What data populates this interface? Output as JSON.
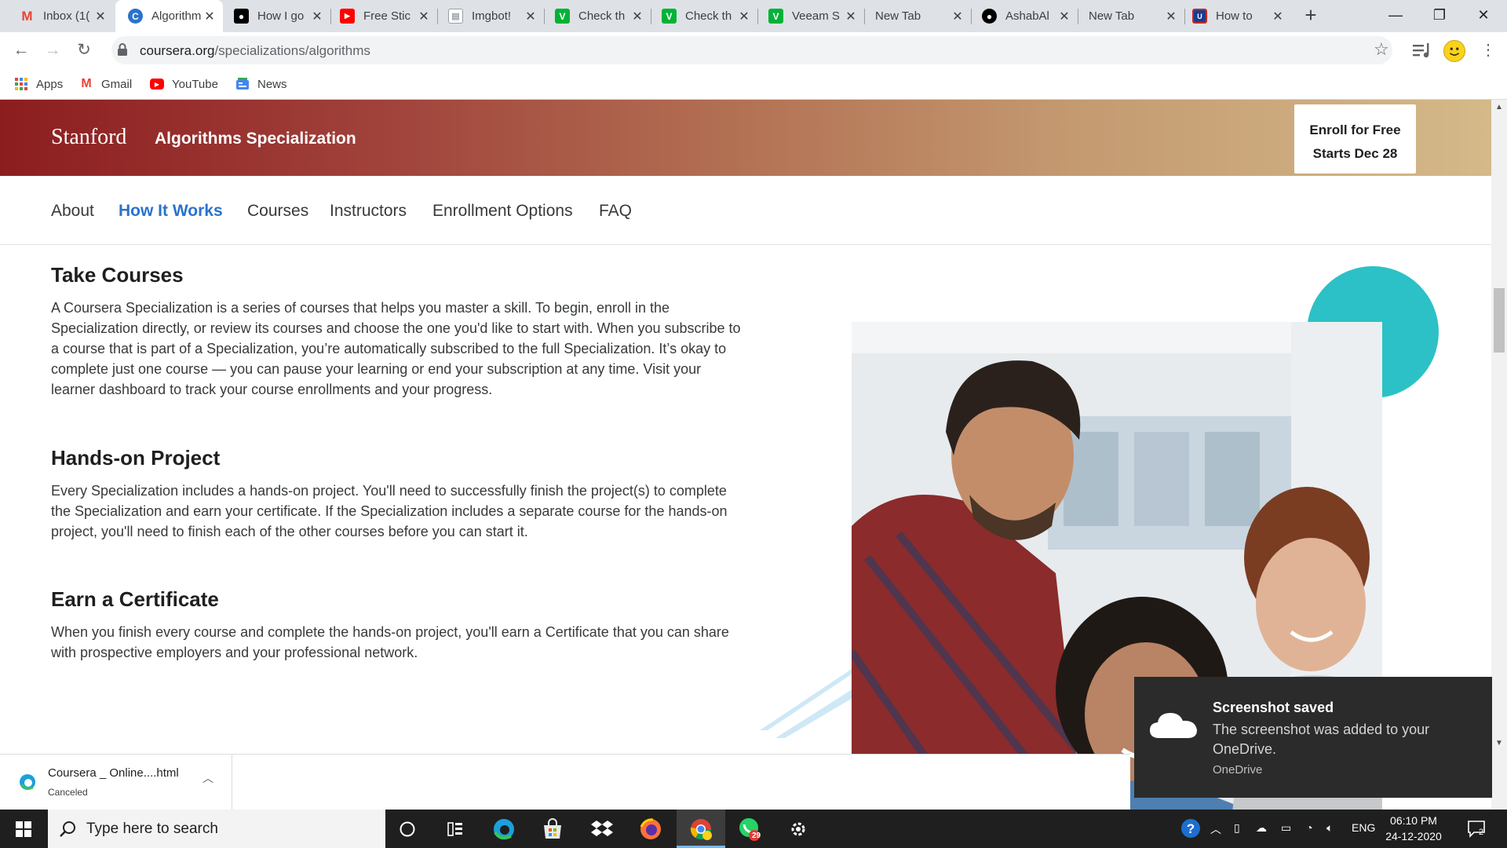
{
  "browser": {
    "tabs": [
      {
        "title": "Inbox (1(",
        "icon": "gmail-icon",
        "color": "#ea4335",
        "glyph": "M"
      },
      {
        "title": "Algorithm",
        "icon": "coursera-icon",
        "color": "#2a73cc",
        "glyph": "C"
      },
      {
        "title": "How I go",
        "icon": "medium-icon",
        "color": "#000000",
        "glyph": "●"
      },
      {
        "title": "Free Stic",
        "icon": "youtube-icon",
        "color": "#ff0000",
        "glyph": "▶"
      },
      {
        "title": "Imgbot!",
        "icon": "document-icon",
        "color": "#9aa0a6",
        "glyph": "▤"
      },
      {
        "title": "Check th",
        "icon": "veeam-icon",
        "color": "#00b336",
        "glyph": "V"
      },
      {
        "title": "Check th",
        "icon": "veeam-icon",
        "color": "#00b336",
        "glyph": "V"
      },
      {
        "title": "Veeam S",
        "icon": "veeam-icon",
        "color": "#00b336",
        "glyph": "V"
      },
      {
        "title": "New Tab",
        "icon": "",
        "color": "",
        "glyph": ""
      },
      {
        "title": "AshabAl",
        "icon": "github-icon",
        "color": "#000000",
        "glyph": "●"
      },
      {
        "title": "New Tab",
        "icon": "",
        "color": "",
        "glyph": ""
      },
      {
        "title": "How to",
        "icon": "usn-icon",
        "color": "#c62828",
        "glyph": "U"
      }
    ],
    "url_host": "coursera.org",
    "url_path": "/specializations/algorithms",
    "bookmarks": [
      {
        "label": "Apps",
        "icon": "apps-grid-icon"
      },
      {
        "label": "Gmail",
        "icon": "gmail-icon"
      },
      {
        "label": "YouTube",
        "icon": "youtube-icon"
      },
      {
        "label": "News",
        "icon": "news-icon"
      }
    ]
  },
  "page": {
    "university": "Stanford",
    "spec_title": "Algorithms Specialization",
    "enroll_line1": "Enroll for Free",
    "enroll_line2": "Starts Dec 28",
    "nav": [
      "About",
      "How It Works",
      "Courses",
      "Instructors",
      "Enrollment Options",
      "FAQ"
    ],
    "nav_active": "How It Works",
    "sections": [
      {
        "heading": "Take Courses",
        "body": "A Coursera Specialization is a series of courses that helps you master a skill. To begin, enroll in the Specialization directly, or review its courses and choose the one you'd like to start with. When you subscribe to a course that is part of a Specialization, you’re automatically subscribed to the full Specialization. It’s okay to complete just one course — you can pause your learning or end your subscription at any time. Visit your learner dashboard to track your course enrollments and your progress."
      },
      {
        "heading": "Hands-on Project",
        "body": "Every Specialization includes a hands-on project. You'll need to successfully finish the project(s) to complete the Specialization and earn your certificate. If the Specialization includes a separate course for the hands-on project, you'll need to finish each of the other courses before you can start it."
      },
      {
        "heading": "Earn a Certificate",
        "body": "When you finish every course and complete the hands-on project, you'll earn a Certificate that you can share with prospective employers and your professional network."
      }
    ]
  },
  "download": {
    "name": "Coursera _ Online....html",
    "status": "Canceled"
  },
  "toast": {
    "title": "Screenshot saved",
    "message": "The screenshot was added to your OneDrive.",
    "source": "OneDrive"
  },
  "taskbar": {
    "search_placeholder": "Type here to search",
    "whatsapp_badge": "29",
    "language": "ENG",
    "time": "06:10 PM",
    "date": "24-12-2020",
    "notification_count": "2"
  },
  "colors": {
    "accent": "#2a73cc",
    "banner_start": "#8c1d1f",
    "banner_end": "#d4b989",
    "teal": "#2cc1c6"
  }
}
